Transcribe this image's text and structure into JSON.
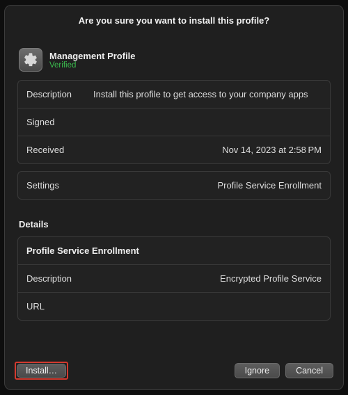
{
  "title": "Are you sure you want to install this profile?",
  "profile": {
    "name": "Management Profile",
    "status": "Verified",
    "status_color": "#3bbf4e"
  },
  "info": {
    "description_label": "Description",
    "description_value": "Install this profile to get access to your company apps",
    "signed_label": "Signed",
    "signed_value": "",
    "received_label": "Received",
    "received_value": "Nov 14, 2023 at 2:58 PM"
  },
  "settings": {
    "label": "Settings",
    "value": "Profile Service Enrollment"
  },
  "details": {
    "heading": "Details",
    "section_title": "Profile Service Enrollment",
    "description_label": "Description",
    "description_value": "Encrypted Profile Service",
    "url_label": "URL",
    "url_value": ""
  },
  "buttons": {
    "install": "Install…",
    "ignore": "Ignore",
    "cancel": "Cancel"
  }
}
